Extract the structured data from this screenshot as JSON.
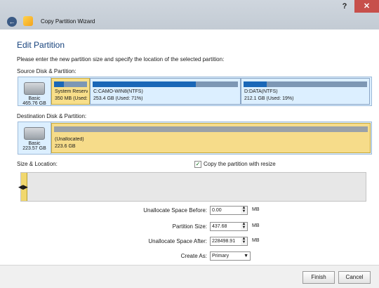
{
  "window": {
    "title": "Copy Partition Wizard",
    "help_label": "?",
    "close_label": "✕",
    "back_glyph": "←"
  },
  "page": {
    "title": "Edit Partition",
    "instructions": "Please enter the new partition size and specify the location of the selected partition:"
  },
  "source": {
    "label": "Source Disk & Partition:",
    "disk": {
      "type": "Basic",
      "size": "465.76 GB"
    },
    "partitions": [
      {
        "name": "System Reserv",
        "info": "350 MB (Used:",
        "used_fraction": 0.3,
        "selected": true
      },
      {
        "name": "C:CAMO-WIN8(NTFS)",
        "info": "253.4 GB (Used: 71%)",
        "used_fraction": 0.71,
        "selected": false
      },
      {
        "name": "D:DATA(NTFS)",
        "info": "212.1 GB (Used: 19%)",
        "used_fraction": 0.19,
        "selected": false
      }
    ]
  },
  "destination": {
    "label": "Destination Disk & Partition:",
    "disk": {
      "type": "Basic",
      "size": "223.57 GB"
    },
    "partition": {
      "name": "(Unallocated)",
      "info": "223.6 GB"
    }
  },
  "size_location": {
    "label": "Size & Location:",
    "checkbox_label": "Copy the partition with resize",
    "checkbox_checked": true,
    "check_glyph": "✓"
  },
  "form": {
    "before": {
      "label": "Unallocate Space Before:",
      "value": "0.00",
      "unit": "MB"
    },
    "size": {
      "label": "Partition Size:",
      "value": "437.68",
      "unit": "MB"
    },
    "after": {
      "label": "Unallocate Space After:",
      "value": "228498.91",
      "unit": "MB"
    },
    "create_as": {
      "label": "Create As:",
      "value": "Primary"
    }
  },
  "buttons": {
    "finish": "Finish",
    "cancel": "Cancel"
  },
  "colors": {
    "accent": "#16427c",
    "selected_partition": "#f8df8a",
    "unallocated_partition": "#f6dc8a",
    "used_bar": "#1a67b7",
    "close_button": "#c7504b"
  },
  "icons": [
    "back-arrow-icon",
    "wizard-app-icon",
    "disk-drive-icon",
    "checkmark-icon",
    "slider-arrow-icon",
    "spin-up-icon",
    "spin-down-icon",
    "chevron-down-icon"
  ]
}
